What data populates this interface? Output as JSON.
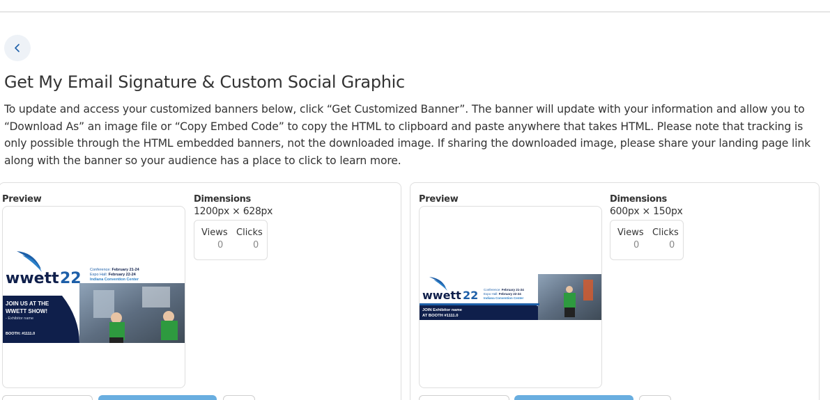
{
  "page": {
    "title": "Get My Email Signature & Custom Social Graphic",
    "description": "To update and access your customized banners below, click “Get Customized Banner”. The banner will update with your information and allow you to “Download As” an image file or “Copy Embed Code” to copy the HTML to clipboard and paste anywhere that takes HTML. Please note that tracking is only possible through the HTML embedded banners, not the downloaded image. If sharing the downloaded image, please share your landing page link along with the banner so your audience has a place to click to learn more."
  },
  "cards": [
    {
      "preview_label": "Preview",
      "dimensions_label": "Dimensions",
      "dimensions_value": "1200px × 628px",
      "views_label": "Views",
      "clicks_label": "Clicks",
      "views": "0",
      "clicks": "0",
      "banner": {
        "logo_text": "wwett",
        "logo_num": "22",
        "conference": "Conference:",
        "conference_dates": "February 21-24",
        "expo": "Expo Hall:",
        "expo_dates": "February 22-24",
        "venue": "Indiana Convention Center",
        "cta_line1": "JOIN US AT THE",
        "cta_line2": "WWETT SHOW!",
        "exhibitor": "- Exhibitor name",
        "booth": "BOOTH: #1111.0"
      }
    },
    {
      "preview_label": "Preview",
      "dimensions_label": "Dimensions",
      "dimensions_value": "600px × 150px",
      "views_label": "Views",
      "clicks_label": "Clicks",
      "views": "0",
      "clicks": "0",
      "banner": {
        "logo_text": "wwett",
        "logo_num": "22",
        "conference": "Conference:",
        "conference_dates": "February 21-24",
        "expo": "Expo Hall:",
        "expo_dates": "February 22-24",
        "venue": "Indiana Convention Center",
        "cta_line1": "JOIN Exhibitor name",
        "cta_line2": "AT BOOTH #1111.0"
      }
    }
  ],
  "colors": {
    "accent_button": "#69aee0",
    "navy": "#0f1f4b",
    "brand_blue": "#1d5fa8",
    "back_bg": "#eef2f7"
  },
  "icons": {
    "back": "chevron-left-icon"
  }
}
